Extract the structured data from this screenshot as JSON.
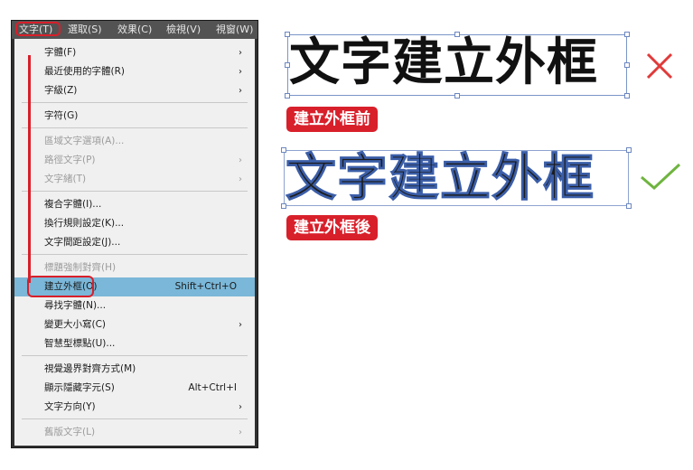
{
  "menubar": {
    "items": [
      "文字(T)",
      "選取(S)",
      "效果(C)",
      "檢視(V)",
      "視窗(W)"
    ]
  },
  "menu": {
    "items": [
      {
        "label": "字體(F)",
        "shortcut": "",
        "submenu": true,
        "disabled": false
      },
      {
        "label": "最近使用的字體(R)",
        "shortcut": "",
        "submenu": true,
        "disabled": false
      },
      {
        "label": "字級(Z)",
        "shortcut": "",
        "submenu": true,
        "disabled": false
      },
      {
        "label": "字符(G)",
        "shortcut": "",
        "submenu": false,
        "disabled": false
      },
      {
        "label": "區域文字選項(A)...",
        "shortcut": "",
        "submenu": false,
        "disabled": true
      },
      {
        "label": "路徑文字(P)",
        "shortcut": "",
        "submenu": true,
        "disabled": true
      },
      {
        "label": "文字緒(T)",
        "shortcut": "",
        "submenu": true,
        "disabled": true
      },
      {
        "label": "複合字體(I)...",
        "shortcut": "",
        "submenu": false,
        "disabled": false
      },
      {
        "label": "換行規則設定(K)...",
        "shortcut": "",
        "submenu": false,
        "disabled": false
      },
      {
        "label": "文字間距設定(J)...",
        "shortcut": "",
        "submenu": false,
        "disabled": false
      },
      {
        "label": "標題強制對齊(H)",
        "shortcut": "",
        "submenu": false,
        "disabled": true
      },
      {
        "label": "建立外框(O)",
        "shortcut": "Shift+Ctrl+O",
        "submenu": false,
        "disabled": false,
        "selected": true
      },
      {
        "label": "尋找字體(N)...",
        "shortcut": "",
        "submenu": false,
        "disabled": false
      },
      {
        "label": "變更大小寫(C)",
        "shortcut": "",
        "submenu": true,
        "disabled": false
      },
      {
        "label": "智慧型標點(U)...",
        "shortcut": "",
        "submenu": false,
        "disabled": false
      },
      {
        "label": "視覺邊界對齊方式(M)",
        "shortcut": "",
        "submenu": false,
        "disabled": false
      },
      {
        "label": "顯示隱藏字元(S)",
        "shortcut": "Alt+Ctrl+I",
        "submenu": false,
        "disabled": false
      },
      {
        "label": "文字方向(Y)",
        "shortcut": "",
        "submenu": true,
        "disabled": false
      },
      {
        "label": "舊版文字(L)",
        "shortcut": "",
        "submenu": true,
        "disabled": true
      }
    ],
    "arrow_glyph": "›"
  },
  "comparison": {
    "sample_text": "文字建立外框",
    "before_caption": "建立外框前",
    "after_caption": "建立外框後",
    "wrong_mark": "✕",
    "right_mark": "✓"
  },
  "colors": {
    "highlight_red": "#d81f2a",
    "selected_bg": "#7ab7d8",
    "check_green": "#6fb43f",
    "cross_red": "#e03a3a"
  }
}
